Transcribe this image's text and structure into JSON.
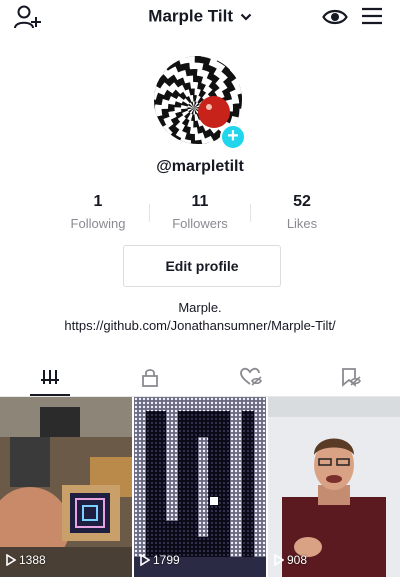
{
  "header": {
    "title": "Marple Tilt",
    "icons": [
      "add-user-icon",
      "chevron-down-icon",
      "eye-icon",
      "menu-icon"
    ]
  },
  "profile": {
    "username": "@marpletilt",
    "avatar_icon": "plus-icon"
  },
  "stats": [
    {
      "value": "1",
      "label": "Following"
    },
    {
      "value": "11",
      "label": "Followers"
    },
    {
      "value": "52",
      "label": "Likes"
    }
  ],
  "edit_profile_label": "Edit profile",
  "bio": {
    "name": "Marple.",
    "link": "https://github.com/Jonathansumner/Marple-Tilt/"
  },
  "tabs": [
    {
      "icon": "videos-grid-icon",
      "active": true
    },
    {
      "icon": "lock-icon",
      "active": false
    },
    {
      "icon": "liked-hidden-icon",
      "active": false
    },
    {
      "icon": "saved-hidden-icon",
      "active": false
    }
  ],
  "videos": [
    {
      "views": "1388"
    },
    {
      "views": "1799"
    },
    {
      "views": "908"
    }
  ],
  "colors": {
    "accent": "#20d5ec",
    "text": "#161823",
    "muted": "#8a8b91"
  }
}
